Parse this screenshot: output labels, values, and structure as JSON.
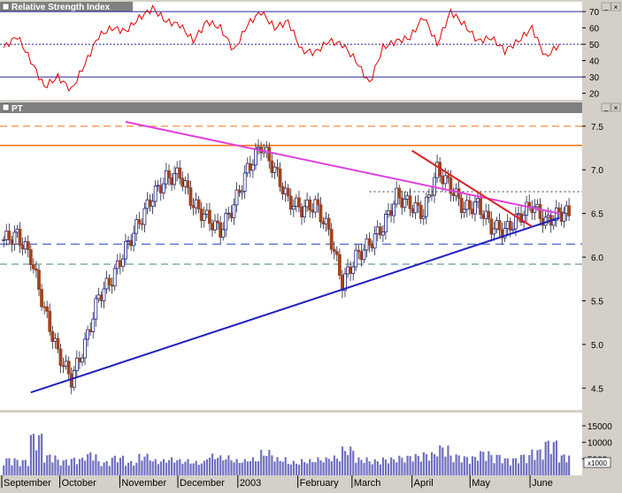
{
  "panels": {
    "rsi": {
      "title": "Relative Strength Index",
      "ticks": [
        70,
        60,
        50,
        40,
        30,
        20
      ],
      "ylim": [
        16,
        76
      ]
    },
    "price": {
      "title": "PT",
      "ticks": [
        7.5,
        7.0,
        6.5,
        6.0,
        5.5,
        5.0,
        4.5
      ],
      "ylim": [
        4.25,
        7.65
      ]
    },
    "volume": {
      "ticks": [
        "15000",
        "10000",
        "5000"
      ],
      "unit_label": "x1000",
      "ylim": [
        0,
        19000
      ]
    }
  },
  "months": [
    "September",
    "October",
    "November",
    "December",
    "2003",
    "February",
    "March",
    "April",
    "May",
    "June"
  ],
  "window_buttons": {
    "minimize": "_",
    "close": "×"
  },
  "colors": {
    "background": "#ffffff",
    "chrome": "#d4d0c8",
    "title_bar": "#808080",
    "up_candle": "#1a237e",
    "down_candle": "#a0441e",
    "rsi_line": "#e00000",
    "volume_bar": "#7070c0",
    "support_line": "#2020c0",
    "resistance_line": "#e040e0",
    "short_trend": "#e02020",
    "horizontal_level": "#f07010",
    "dashed_level": "#2040c0"
  },
  "chart_data": [
    {
      "type": "line",
      "title": "Relative Strength Index",
      "ylim": [
        16,
        76
      ],
      "reference_levels": [
        70,
        50,
        30
      ],
      "x": [
        "2002-09-02",
        "2002-09-09",
        "2002-09-16",
        "2002-09-23",
        "2002-09-30",
        "2002-10-07",
        "2002-10-14",
        "2002-10-21",
        "2002-10-28",
        "2002-11-04",
        "2002-11-11",
        "2002-11-18",
        "2002-11-25",
        "2002-12-02",
        "2002-12-09",
        "2002-12-16",
        "2002-12-23",
        "2002-12-30",
        "2003-01-06",
        "2003-01-13",
        "2003-01-20",
        "2003-01-27",
        "2003-02-03",
        "2003-02-10",
        "2003-02-17",
        "2003-02-24",
        "2003-03-03",
        "2003-03-10",
        "2003-03-17",
        "2003-03-24",
        "2003-03-31",
        "2003-04-07",
        "2003-04-14",
        "2003-04-21",
        "2003-04-28",
        "2003-05-05",
        "2003-05-12",
        "2003-05-19",
        "2003-05-26",
        "2003-06-02",
        "2003-06-09",
        "2003-06-16"
      ],
      "values": [
        48,
        55,
        40,
        24,
        30,
        22,
        38,
        55,
        60,
        58,
        66,
        72,
        64,
        62,
        52,
        64,
        60,
        46,
        62,
        70,
        60,
        64,
        46,
        45,
        52,
        50,
        40,
        26,
        48,
        52,
        54,
        67,
        50,
        70,
        62,
        52,
        54,
        46,
        52,
        60,
        42,
        50
      ]
    },
    {
      "type": "candlestick",
      "title": "PT",
      "ylim": [
        4.25,
        7.65
      ],
      "x": [
        "2002-09-02",
        "2002-09-09",
        "2002-09-16",
        "2002-09-23",
        "2002-09-30",
        "2002-10-07",
        "2002-10-14",
        "2002-10-21",
        "2002-10-28",
        "2002-11-04",
        "2002-11-11",
        "2002-11-18",
        "2002-11-25",
        "2002-12-02",
        "2002-12-09",
        "2002-12-16",
        "2002-12-23",
        "2002-12-30",
        "2003-01-06",
        "2003-01-13",
        "2003-01-20",
        "2003-01-27",
        "2003-02-03",
        "2003-02-10",
        "2003-02-17",
        "2003-02-24",
        "2003-03-03",
        "2003-03-10",
        "2003-03-17",
        "2003-03-24",
        "2003-03-31",
        "2003-04-07",
        "2003-04-14",
        "2003-04-21",
        "2003-04-28",
        "2003-05-05",
        "2003-05-12",
        "2003-05-19",
        "2003-05-26",
        "2003-06-02",
        "2003-06-09",
        "2003-06-16"
      ],
      "close": [
        6.2,
        6.25,
        6.0,
        5.4,
        4.9,
        4.6,
        5.0,
        5.55,
        5.75,
        6.1,
        6.4,
        6.7,
        6.9,
        6.95,
        6.6,
        6.45,
        6.3,
        6.6,
        7.0,
        7.28,
        7.0,
        6.65,
        6.55,
        6.6,
        6.3,
        5.7,
        6.0,
        6.15,
        6.35,
        6.7,
        6.6,
        6.5,
        7.0,
        6.8,
        6.55,
        6.6,
        6.35,
        6.3,
        6.45,
        6.6,
        6.4,
        6.5
      ],
      "reference_levels": [
        7.5,
        7.28,
        6.75,
        6.15,
        5.92
      ],
      "trendlines": [
        {
          "name": "support",
          "from": [
            "2002-09-16",
            4.45
          ],
          "to": [
            "2003-06-16",
            6.45
          ]
        },
        {
          "name": "resistance",
          "from": [
            "2002-11-04",
            7.55
          ],
          "to": [
            "2003-06-16",
            6.5
          ]
        },
        {
          "name": "short-term",
          "from": [
            "2003-04-01",
            7.22
          ],
          "to": [
            "2003-06-02",
            6.35
          ]
        }
      ]
    },
    {
      "type": "bar",
      "title": "",
      "ylim": [
        0,
        19000
      ],
      "x": [
        "2002-09-02",
        "2002-09-09",
        "2002-09-16",
        "2002-09-23",
        "2002-09-30",
        "2002-10-07",
        "2002-10-14",
        "2002-10-21",
        "2002-10-28",
        "2002-11-04",
        "2002-11-11",
        "2002-11-18",
        "2002-11-25",
        "2002-12-02",
        "2002-12-09",
        "2002-12-16",
        "2002-12-23",
        "2002-12-30",
        "2003-01-06",
        "2003-01-13",
        "2003-01-20",
        "2003-01-27",
        "2003-02-03",
        "2003-02-10",
        "2003-02-17",
        "2003-02-24",
        "2003-03-03",
        "2003-03-10",
        "2003-03-17",
        "2003-03-24",
        "2003-03-31",
        "2003-04-07",
        "2003-04-14",
        "2003-04-21",
        "2003-04-28",
        "2003-05-05",
        "2003-05-12",
        "2003-05-19",
        "2003-05-26",
        "2003-06-02",
        "2003-06-09",
        "2003-06-16"
      ],
      "values": [
        5000,
        4500,
        12000,
        6000,
        4500,
        5000,
        6500,
        4000,
        5500,
        4000,
        6000,
        4500,
        5000,
        4500,
        4000,
        6000,
        5500,
        4500,
        5000,
        7000,
        5000,
        4000,
        4500,
        5000,
        5500,
        8000,
        5000,
        4500,
        5000,
        5500,
        6000,
        6500,
        8500,
        6000,
        5500,
        7000,
        6000,
        5000,
        6000,
        7500,
        10000,
        6000
      ]
    }
  ]
}
